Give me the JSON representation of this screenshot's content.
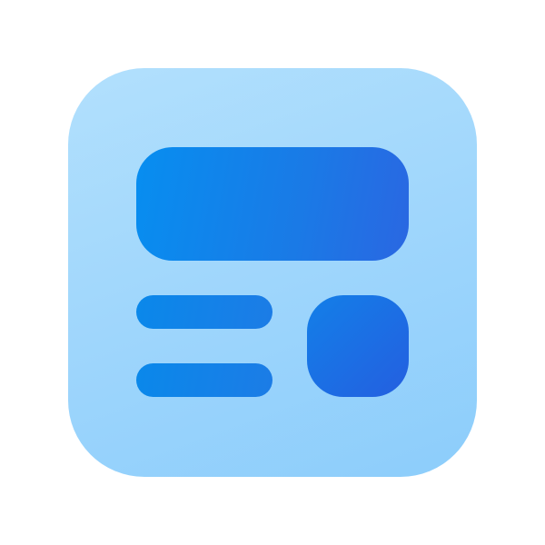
{
  "icon": {
    "name": "layout-dashboard-icon",
    "colors": {
      "background_light": "#b2e0fd",
      "background_dark": "#8ccdfb",
      "accent_light": "#0a8aea",
      "accent_dark": "#2a63e2"
    }
  }
}
